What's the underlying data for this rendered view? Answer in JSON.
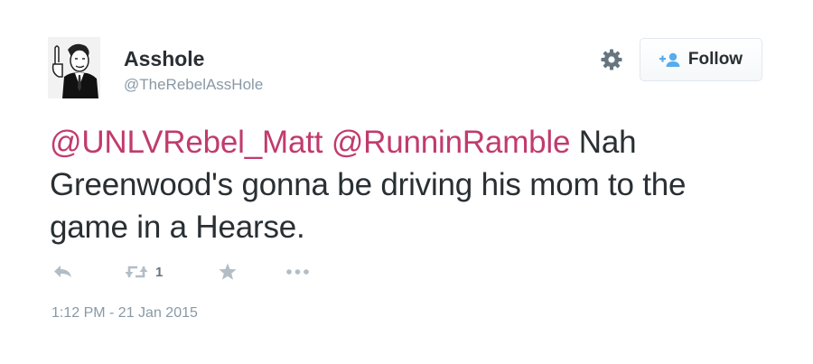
{
  "tweet": {
    "user": {
      "name": "Asshole",
      "handle": "@TheRebelAssHole",
      "avatar_icon": "vintage-businessman-avatar"
    },
    "follow_button": {
      "label": "Follow",
      "icon": "add-user-icon"
    },
    "settings_icon": "gear-icon",
    "text": {
      "mention_1": "@UNLVRebel_Matt",
      "mention_2": "@RunninRamble",
      "body": " Nah Greenwood's gonna be driving his mom to the game in a Hearse."
    },
    "actions": {
      "reply_icon": "reply-icon",
      "retweet_icon": "retweet-icon",
      "retweet_count": "1",
      "favorite_icon": "star-icon",
      "more_icon": "more-icon"
    },
    "timestamp": "1:12 PM - 21 Jan 2015",
    "colors": {
      "mention": "#c13b6d",
      "text": "#292f33",
      "muted": "#8899a6",
      "icon": "#b2bdc6",
      "follow_icon": "#55acee"
    }
  }
}
